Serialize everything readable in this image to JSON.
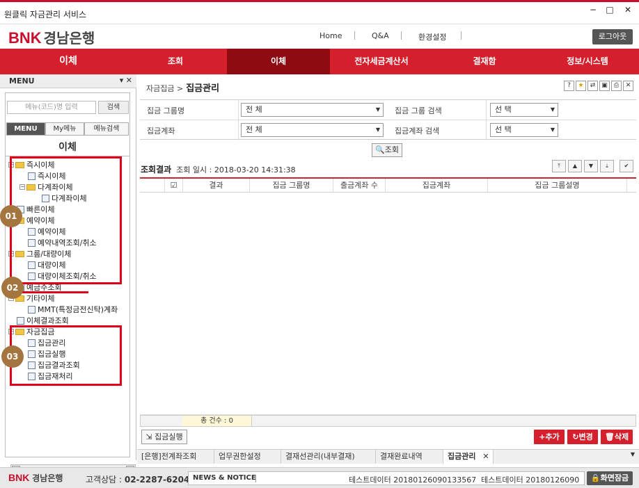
{
  "window": {
    "title": "원클릭 자금관리 서비스",
    "minimize": "−",
    "maximize": "□",
    "close": "✕"
  },
  "header": {
    "logo_mark": "BNK",
    "logo_text": "경남은행",
    "nav": [
      "Home",
      "Q&A",
      "환경설정"
    ],
    "logout": "로그아웃"
  },
  "topmenu": {
    "items": [
      "이체",
      "조회",
      "이체",
      "전자세금계산서",
      "결재함",
      "정보/시스템"
    ],
    "active_index": 2
  },
  "sidebar": {
    "header": "MENU",
    "header_controls": "▾ ✕",
    "search_placeholder": "메뉴(코드)명 입력",
    "search_button": "검색",
    "tabs": [
      "MENU",
      "My메뉴",
      "메뉴검색"
    ],
    "title": "이체",
    "tree": [
      {
        "label": "즉시이체",
        "type": "folder",
        "level": 0
      },
      {
        "label": "즉시이체",
        "type": "doc",
        "level": 1
      },
      {
        "label": "다계좌이체",
        "type": "folder",
        "level": 1
      },
      {
        "label": "다계좌이체",
        "type": "doc",
        "level": 2
      },
      {
        "label": "빠른이체",
        "type": "doc",
        "level": 0
      },
      {
        "label": "예약이체",
        "type": "folder",
        "level": 0
      },
      {
        "label": "예약이체",
        "type": "doc",
        "level": 1
      },
      {
        "label": "예약내역조회/취소",
        "type": "doc",
        "level": 1
      },
      {
        "label": "그룹/대량이체",
        "type": "folder",
        "level": 0
      },
      {
        "label": "대량이체",
        "type": "doc",
        "level": 1
      },
      {
        "label": "대량이체조회/취소",
        "type": "doc",
        "level": 1
      },
      {
        "label": "예금주조회",
        "type": "doc",
        "level": 0
      },
      {
        "label": "기타이체",
        "type": "folder",
        "level": 0
      },
      {
        "label": "MMT(특정금전신탁)계좌",
        "type": "doc",
        "level": 1
      },
      {
        "label": "이체결과조회",
        "type": "doc",
        "level": 0
      },
      {
        "label": "자금집금",
        "type": "folder",
        "level": 0
      },
      {
        "label": "집금관리",
        "type": "doc",
        "level": 1
      },
      {
        "label": "집금실행",
        "type": "doc",
        "level": 1
      },
      {
        "label": "집금결과조회",
        "type": "doc",
        "level": 1
      },
      {
        "label": "집금재처리",
        "type": "doc",
        "level": 1
      }
    ],
    "badges": [
      "01",
      "02",
      "03"
    ]
  },
  "main": {
    "breadcrumb_parent": "자금집금 >",
    "breadcrumb_current": "집금관리",
    "toolbar_icons": [
      "?",
      "★",
      "⇄",
      "▣",
      "⎙",
      "✕"
    ],
    "form": {
      "group_name_label": "집금 그룹명",
      "group_name_value": "전      체",
      "group_search_label": "집금 그룹 검색",
      "group_search_value": "선      택",
      "account_label": "집금계좌",
      "account_value": "전      체",
      "account_search_label": "집금계좌 검색",
      "account_search_value": "선      택"
    },
    "search_button": "조회",
    "result_title": "조회결과",
    "result_time": "조회 일시 : 2018-03-20 14:31:38",
    "sort_buttons": [
      "⤒",
      "▲",
      "▼",
      "⤓",
      "✔"
    ],
    "columns": [
      "☑",
      "결과",
      "집금 그룹명",
      "출금계좌 수",
      "집금계좌",
      "집금 그룹설명"
    ],
    "total": "총 건수 : 0",
    "exec_button": "집금실행",
    "add_button": "+추가",
    "change_button": "변경",
    "delete_button": "삭제"
  },
  "doc_tabs": [
    "[은행]전계좌조회",
    "업무권한설정",
    "결재선관리(내부결재)",
    "결재완료내역",
    "집금관리"
  ],
  "footer": {
    "logo_mark": "BNK",
    "logo_text": "경남은행",
    "cs_label": "고객상담 :",
    "cs_phone": "02-2287-6204",
    "news_label": "NEWS & NOTICE",
    "news1": "테스트데이터 20180126090133567",
    "news2": "테스트데이터 20180126090",
    "lock": "화면잠금"
  },
  "colors": {
    "brand_red": "#d61f2c",
    "active_menu": "#8e0b12",
    "badge": "#a5753f",
    "highlight_box": "#e0001a"
  }
}
